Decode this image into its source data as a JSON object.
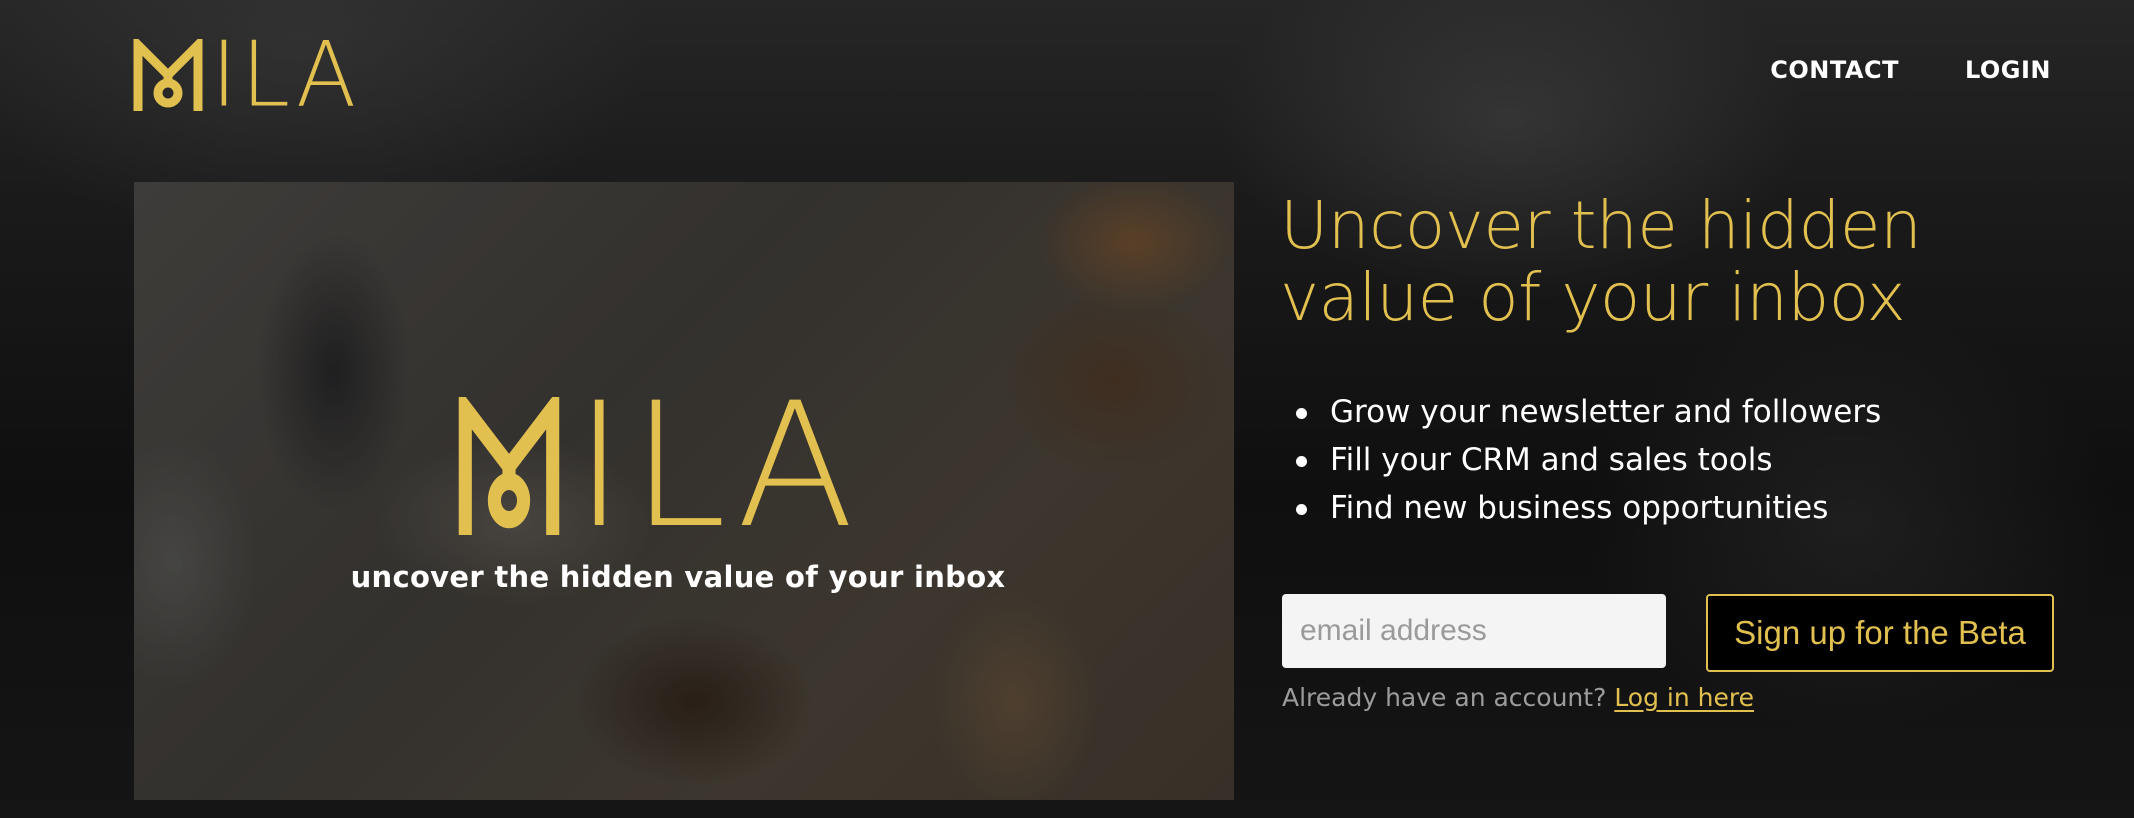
{
  "brand": {
    "name": "MILA",
    "wordmark_rest": "ILA",
    "accent_color": "#e2c050"
  },
  "nav": {
    "items": [
      {
        "label": "CONTACT"
      },
      {
        "label": "LOGIN"
      }
    ]
  },
  "hero": {
    "logo_text": "MILA",
    "logo_rest": "ILA",
    "tagline": "uncover the hidden value of your inbox"
  },
  "main": {
    "headline": "Uncover the hidden value of your inbox",
    "features": [
      "Grow your newsletter and followers",
      "Fill your CRM and sales tools",
      "Find new business opportunities"
    ],
    "email_placeholder": "email address",
    "email_value": "",
    "signup_label": "Sign up for the Beta",
    "account_prompt": "Already have an account?",
    "login_link": "Log in here"
  },
  "icons": {
    "logo_mark": "mila-m-icon",
    "list_bullet": "bullet-icon"
  }
}
